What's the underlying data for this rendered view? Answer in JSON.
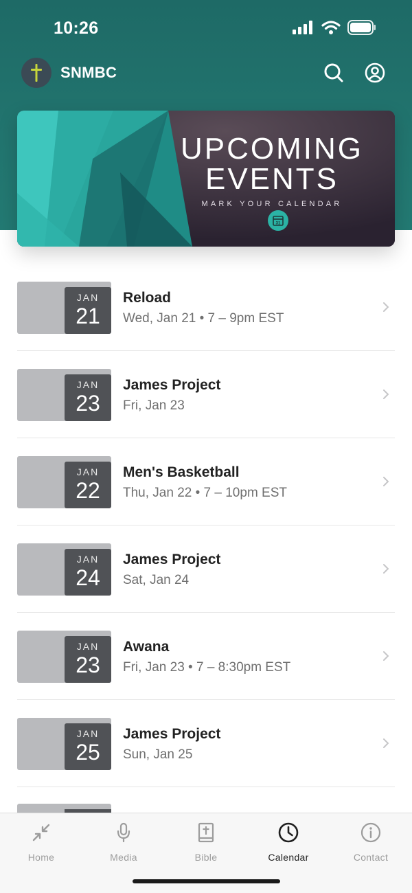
{
  "status_bar": {
    "time": "10:26"
  },
  "app_bar": {
    "title": "SNMBC"
  },
  "banner": {
    "line1": "UPCOMING",
    "line2": "EVENTS",
    "subtitle": "MARK YOUR CALENDAR",
    "calendar_day": "31"
  },
  "events": [
    {
      "month": "JAN",
      "day": "21",
      "title": "Reload",
      "subtitle": "Wed, Jan 21 • 7 – 9pm EST"
    },
    {
      "month": "JAN",
      "day": "23",
      "title": "James Project",
      "subtitle": "Fri, Jan 23"
    },
    {
      "month": "JAN",
      "day": "22",
      "title": "Men's Basketball",
      "subtitle": "Thu, Jan 22 • 7 – 10pm EST"
    },
    {
      "month": "JAN",
      "day": "24",
      "title": "James Project",
      "subtitle": "Sat, Jan 24"
    },
    {
      "month": "JAN",
      "day": "23",
      "title": "Awana",
      "subtitle": "Fri, Jan 23 • 7 – 8:30pm EST"
    },
    {
      "month": "JAN",
      "day": "25",
      "title": "James Project",
      "subtitle": "Sun, Jan 25"
    }
  ],
  "tab_bar": {
    "tabs": [
      {
        "label": "Home",
        "icon": "collapse-arrows-icon",
        "active": false
      },
      {
        "label": "Media",
        "icon": "microphone-icon",
        "active": false
      },
      {
        "label": "Bible",
        "icon": "bible-icon",
        "active": false
      },
      {
        "label": "Calendar",
        "icon": "clock-icon",
        "active": true
      },
      {
        "label": "Contact",
        "icon": "info-icon",
        "active": false
      }
    ]
  },
  "colors": {
    "header": "#22756f",
    "accent": "#2bb3a5",
    "date_box": "#505256",
    "date_tile": "#b9babd",
    "active_tab": "#1f1f1f",
    "inactive_tab": "#9c9c9c"
  }
}
